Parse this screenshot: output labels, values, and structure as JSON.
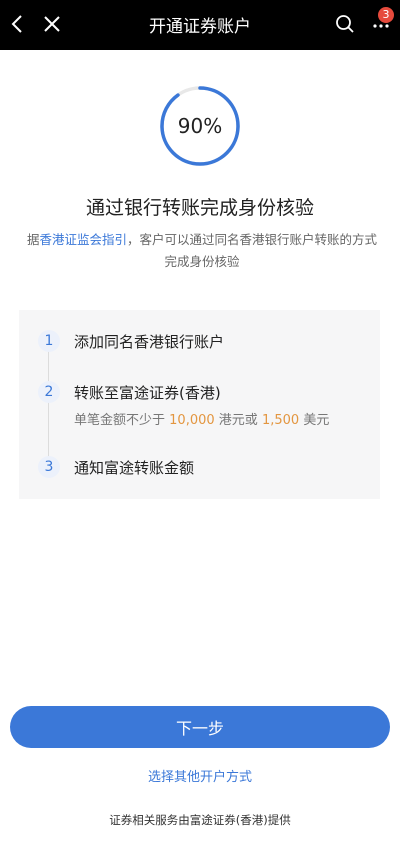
{
  "header": {
    "title": "开通证券账户",
    "badge_count": "3",
    "icons": [
      "back-icon",
      "close-icon",
      "search-icon",
      "more-icon"
    ]
  },
  "progress": {
    "label": "90%",
    "value": 0.9
  },
  "main": {
    "headline": "通过银行转账完成身份核验",
    "desc_prefix": "据",
    "desc_link": "香港证监会指引",
    "desc_suffix": "，客户可以通过同名香港银行账户转账的方式完成身份核验"
  },
  "steps": [
    {
      "num": "1",
      "text": "添加同名香港银行账户"
    },
    {
      "num": "2",
      "text": "转账至富途证券(香港)",
      "sub": {
        "prefix": "单笔金额不少于",
        "amount1": "10,000",
        "mid": "港元或",
        "amount2": "1,500",
        "suffix": "美元"
      }
    },
    {
      "num": "3",
      "text": "通知富途转账金额"
    }
  ],
  "actions": {
    "next_label": "下一步",
    "other_label": "选择其他开户方式"
  },
  "footer": "证券相关服务由富途证券(香港)提供",
  "colors": {
    "accent": "#3b78d8",
    "amount": "#e39640",
    "badge": "#e64a3c"
  }
}
